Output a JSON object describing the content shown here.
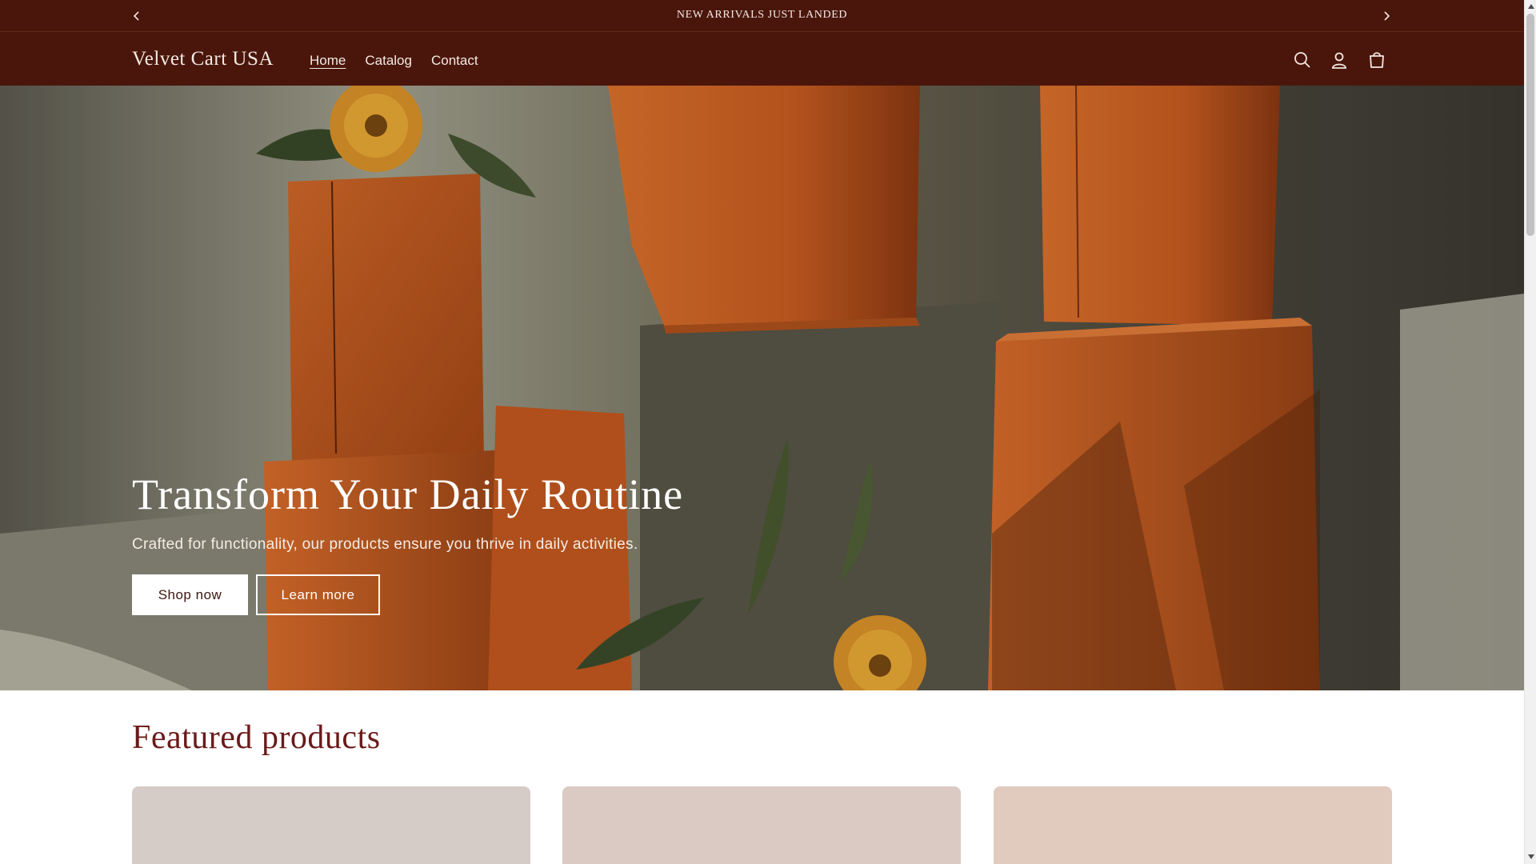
{
  "announcement": {
    "text": "NEW ARRIVALS JUST LANDED",
    "prev_icon": "chevron-left-icon",
    "next_icon": "chevron-right-icon"
  },
  "header": {
    "logo": "Velvet Cart USA",
    "nav": [
      {
        "label": "Home",
        "active": true
      },
      {
        "label": "Catalog",
        "active": false
      },
      {
        "label": "Contact",
        "active": false
      }
    ],
    "icons": [
      "search-icon",
      "account-icon",
      "cart-icon"
    ]
  },
  "hero": {
    "title": "Transform Your Daily Routine",
    "subtitle": "Crafted for functionality, our products ensure you thrive in daily activities.",
    "primary_button": "Shop now",
    "secondary_button": "Learn more"
  },
  "featured": {
    "title": "Featured products"
  },
  "colors": {
    "header_bg": "#4a160b",
    "header_text": "#f3e9e2",
    "featured_title": "#6b1a1a",
    "box_orange": "#d9621c"
  }
}
